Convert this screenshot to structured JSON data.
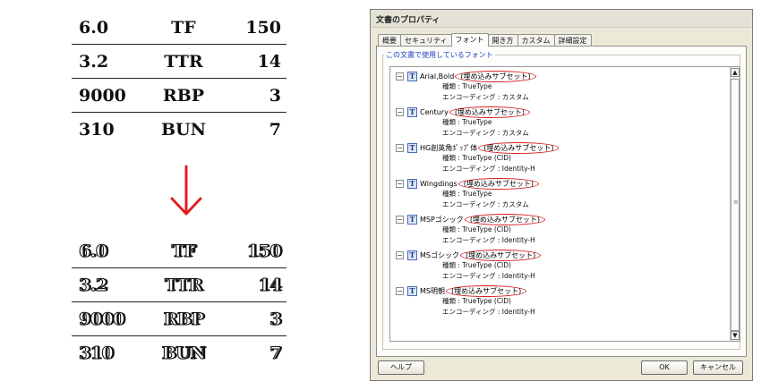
{
  "table_before": {
    "rows": [
      [
        "6.0",
        "TF",
        "150"
      ],
      [
        "3.2",
        "TTR",
        "14"
      ],
      [
        "9000",
        "RBP",
        "3"
      ],
      [
        "310",
        "BUN",
        "7"
      ]
    ]
  },
  "table_after": {
    "rows": [
      [
        "6.0",
        "TF",
        "150"
      ],
      [
        "3.2",
        "TTR",
        "14"
      ],
      [
        "9000",
        "RBP",
        "3"
      ],
      [
        "310",
        "BUN",
        "7"
      ]
    ]
  },
  "colors": {
    "arrow": "#e02020",
    "annotation_circle": "#d81c1c",
    "group_label": "#1e40c8"
  },
  "dialog": {
    "title": "文書のプロパティ",
    "tabs": [
      "概要",
      "セキュリティ",
      "フォント",
      "開き方",
      "カスタム",
      "詳細設定"
    ],
    "active_tab": "フォント",
    "group_label": "この文書で使用しているフォント",
    "fonts": [
      {
        "name": "Arial,Bold",
        "embed": "(埋め込みサブセット)",
        "type": "種類 : TrueType",
        "encoding": "エンコーディング : カスタム"
      },
      {
        "name": "Century",
        "embed": "(埋め込みサブセット)",
        "type": "種類 : TrueType",
        "encoding": "エンコーディング : カスタム"
      },
      {
        "name": "HG創英角ﾎﾟｯﾌﾟ体",
        "embed": "(埋め込みサブセット)",
        "type": "種類 : TrueType (CID)",
        "encoding": "エンコーディング : Identity-H"
      },
      {
        "name": "Wingdings",
        "embed": "(埋め込みサブセット)",
        "type": "種類 : TrueType",
        "encoding": "エンコーディング : カスタム"
      },
      {
        "name": "MSPゴシック",
        "embed": "(埋め込みサブセット)",
        "type": "種類 : TrueType (CID)",
        "encoding": "エンコーディング : Identity-H"
      },
      {
        "name": "MSゴシック",
        "embed": "(埋め込みサブセット)",
        "type": "種類 : TrueType (CID)",
        "encoding": "エンコーディング : Identity-H"
      },
      {
        "name": "MS明朝",
        "embed": "(埋め込みサブセット)",
        "type": "種類 : TrueType (CID)",
        "encoding": "エンコーディング : Identity-H"
      }
    ],
    "buttons": {
      "help": "ヘルプ",
      "ok": "OK",
      "cancel": "キャンセル"
    }
  }
}
